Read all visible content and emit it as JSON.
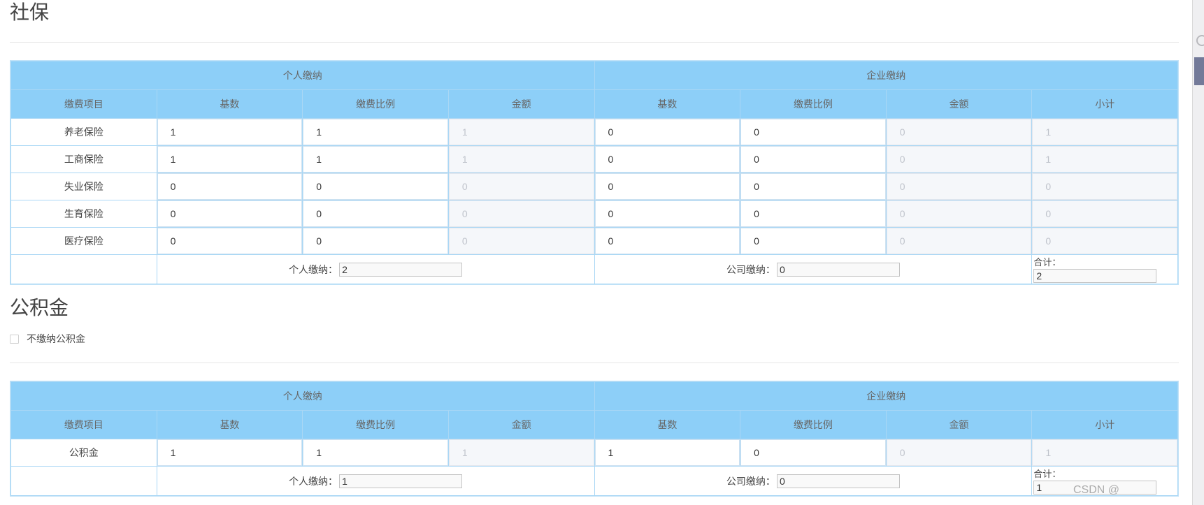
{
  "social_security": {
    "title": "社保",
    "group_headers": {
      "personal": "个人缴纳",
      "company": "企业缴纳"
    },
    "columns": {
      "item": "缴费项目",
      "personal_base": "基数",
      "personal_rate": "缴费比例",
      "personal_amount": "金额",
      "company_base": "基数",
      "company_rate": "缴费比例",
      "company_amount": "金额",
      "subtotal": "小计"
    },
    "rows": [
      {
        "item": "养老保险",
        "personal_base": "1",
        "personal_rate": "1",
        "personal_amount": "1",
        "company_base": "0",
        "company_rate": "0",
        "company_amount": "0",
        "subtotal": "1"
      },
      {
        "item": "工商保险",
        "personal_base": "1",
        "personal_rate": "1",
        "personal_amount": "1",
        "company_base": "0",
        "company_rate": "0",
        "company_amount": "0",
        "subtotal": "1"
      },
      {
        "item": "失业保险",
        "personal_base": "0",
        "personal_rate": "0",
        "personal_amount": "0",
        "company_base": "0",
        "company_rate": "0",
        "company_amount": "0",
        "subtotal": "0"
      },
      {
        "item": "生育保险",
        "personal_base": "0",
        "personal_rate": "0",
        "personal_amount": "0",
        "company_base": "0",
        "company_rate": "0",
        "company_amount": "0",
        "subtotal": "0"
      },
      {
        "item": "医疗保险",
        "personal_base": "0",
        "personal_rate": "0",
        "personal_amount": "0",
        "company_base": "0",
        "company_rate": "0",
        "company_amount": "0",
        "subtotal": "0"
      }
    ],
    "summary": {
      "personal_label": "个人缴纳：",
      "personal_value": "2",
      "company_label": "公司缴纳：",
      "company_value": "0",
      "total_label": "合计：",
      "total_value": "2"
    }
  },
  "housing_fund": {
    "title": "公积金",
    "opt_out_label": "不缴纳公积金",
    "opt_out_checked": false,
    "group_headers": {
      "personal": "个人缴纳",
      "company": "企业缴纳"
    },
    "columns": {
      "item": "缴费项目",
      "personal_base": "基数",
      "personal_rate": "缴费比例",
      "personal_amount": "金额",
      "company_base": "基数",
      "company_rate": "缴费比例",
      "company_amount": "金额",
      "subtotal": "小计"
    },
    "rows": [
      {
        "item": "公积金",
        "personal_base": "1",
        "personal_rate": "1",
        "personal_amount": "1",
        "company_base": "1",
        "company_rate": "0",
        "company_amount": "0",
        "subtotal": "1"
      }
    ],
    "summary": {
      "personal_label": "个人缴纳：",
      "personal_value": "1",
      "company_label": "公司缴纳：",
      "company_value": "0",
      "total_label": "合计：",
      "total_value": "1"
    }
  },
  "watermark": "CSDN @",
  "colors": {
    "header_bg": "#8dcff8",
    "grid_line": "#a9d7f5",
    "disabled_bg": "#f5f7fa",
    "disabled_text": "#c0c4cc"
  }
}
